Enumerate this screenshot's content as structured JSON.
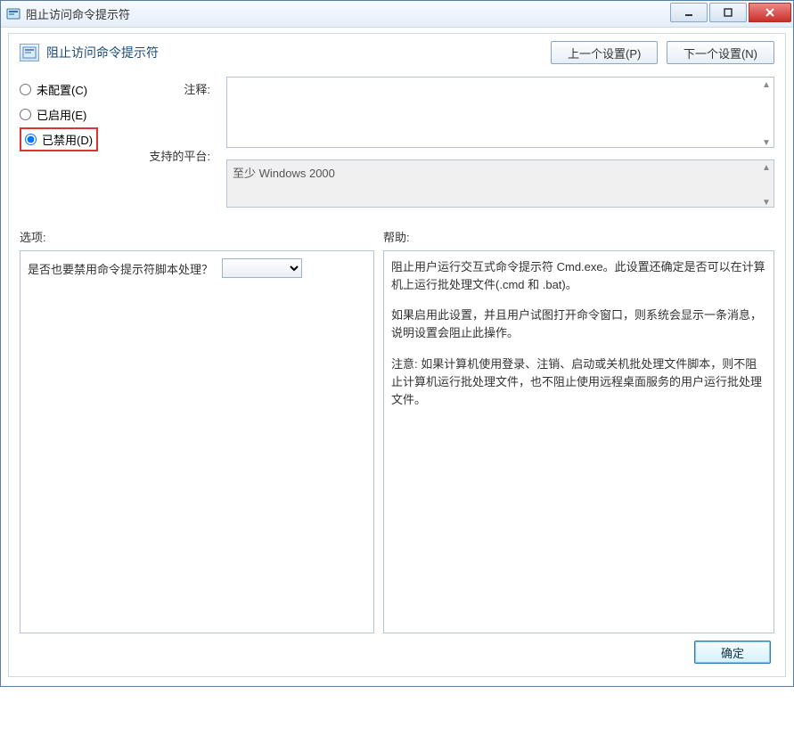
{
  "window": {
    "title": "阻止访问命令提示符"
  },
  "header": {
    "title": "阻止访问命令提示符"
  },
  "nav": {
    "prev": "上一个设置(P)",
    "next": "下一个设置(N)"
  },
  "radios": {
    "not_configured": "未配置(C)",
    "enabled": "已启用(E)",
    "disabled": "已禁用(D)",
    "selected": "disabled"
  },
  "labels": {
    "comment": "注释:",
    "platform": "支持的平台:",
    "options": "选项:",
    "help": "帮助:"
  },
  "fields": {
    "comment_value": "",
    "platform_value": "至少 Windows 2000"
  },
  "options": {
    "q1": "是否也要禁用命令提示符脚本处理？",
    "q1_value": ""
  },
  "help": {
    "p1": "阻止用户运行交互式命令提示符 Cmd.exe。此设置还确定是否可以在计算机上运行批处理文件(.cmd 和 .bat)。",
    "p2": "如果启用此设置，并且用户试图打开命令窗口，则系统会显示一条消息，说明设置会阻止此操作。",
    "p3": "注意: 如果计算机使用登录、注销、启动或关机批处理文件脚本，则不阻止计算机运行批处理文件，也不阻止使用远程桌面服务的用户运行批处理文件。"
  },
  "footer": {
    "ok": "确定"
  }
}
